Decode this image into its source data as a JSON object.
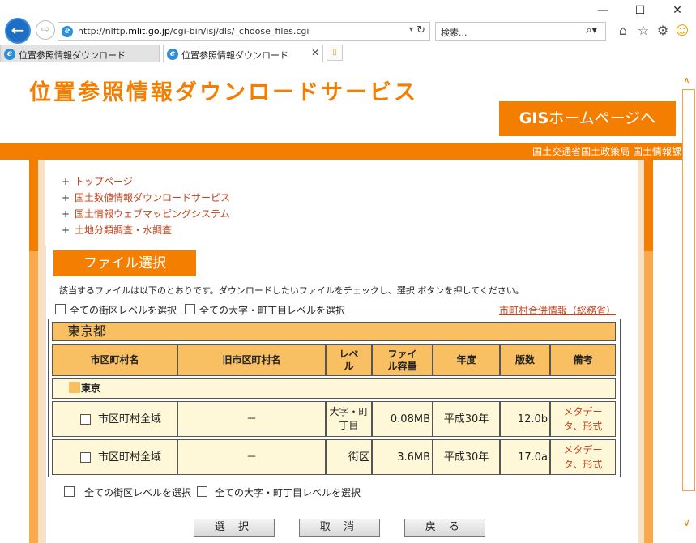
{
  "browser": {
    "url_prefix": "http://nlftp.",
    "url_host": "mlit.go.jp",
    "url_path": "/cgi-bin/isj/dls/_choose_files.cgi",
    "search_placeholder": "検索...",
    "tabs": [
      {
        "label": "位置参照情報ダウンロード"
      },
      {
        "label": "位置参照情報ダウンロード"
      }
    ],
    "icons": {
      "back": "←",
      "forward": "⇨",
      "dropdown": "▾",
      "refresh": "↻",
      "search": "⌕▾",
      "home": "⌂",
      "favorites": "☆",
      "settings": "⚙",
      "smiley": "☺",
      "minimize": "—",
      "maximize": "☐",
      "close_window": "✕",
      "close_tab": "✕",
      "ie": "e",
      "new_tab": "▯"
    }
  },
  "header": {
    "site_title": "位置参照情報ダウンロードサービス",
    "gis_button_bold": "GIS",
    "gis_button_rest": "ホームページへ",
    "ministry": "国土交通省国土政策局 国土情報課"
  },
  "nav": {
    "bullet": "+",
    "items": [
      "トップページ",
      "国土数値情報ダウンロードサービス",
      "国土情報ウェブマッピングシステム",
      "土地分類調査・水調査"
    ]
  },
  "main": {
    "section_title": "ファイル選択",
    "instructions": "該当するファイルは以下のとおりです。ダウンロードしたいファイルをチェックし、選択 ボタンを押してください。",
    "select_all_block": "全ての街区レベルを選択",
    "select_all_town": "全ての大字・町丁目レベルを選択",
    "merge_info_link": "市町村合併情報（総務省）",
    "prefecture": "東京都",
    "city_group": "東京",
    "columns": [
      "市区町村名",
      "旧市区町村名",
      "レベル",
      "ファイル容量",
      "年度",
      "版数",
      "備考"
    ],
    "rows": [
      {
        "name": "市区町村全域",
        "old_name": "－",
        "level": "大字・町丁目",
        "size": "0.08MB",
        "year": "平成30年",
        "version": "12.0b",
        "note": "メタデータ、形式"
      },
      {
        "name": "市区町村全域",
        "old_name": "－",
        "level": "街区",
        "size": "3.6MB",
        "year": "平成30年",
        "version": "17.0a",
        "note": "メタデータ、形式"
      }
    ],
    "buttons": {
      "select": "選 択",
      "cancel": "取 消",
      "back": "戻 る"
    }
  },
  "scrollbar": {
    "up": "∧",
    "down": "∨"
  }
}
